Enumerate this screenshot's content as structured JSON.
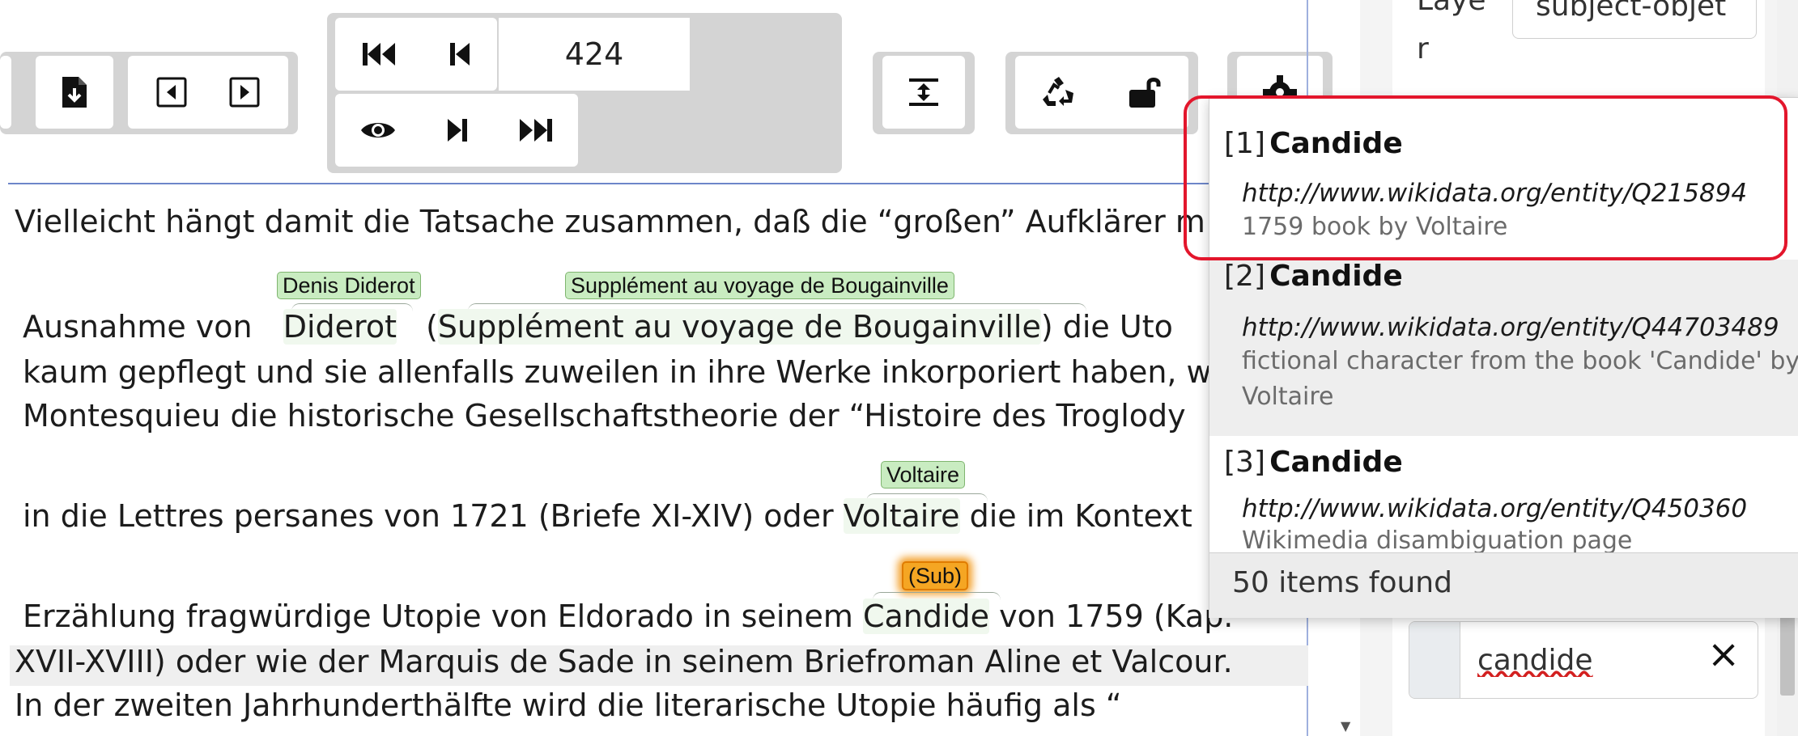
{
  "toolbar": {
    "page_number": "424"
  },
  "document": {
    "lines": [
      "Vielleicht hängt damit die Tatsache zusammen, daß die “großen” Aufklärer m",
      "kaum gepflegt und sie allenfalls zuweilen in ihre Werke inkorporiert haben, w",
      "Montesquieu die historische Gesellschaftstheorie der “Histoire des Troglody",
      "XVII-XVIII) oder wie der Marquis de Sade in seinem Briefroman Aline et Valcour.",
      "In der zweiten Jahrhunderthälfte wird die literarische Utopie häufig als “"
    ],
    "line2": {
      "pre": "Ausnahme von ",
      "span1": "Diderot",
      "mid": " (",
      "span2": "Supplément au voyage de Bougainville",
      "post": ") die Uto"
    },
    "line5": {
      "pre": "in die Lettres persanes von 1721 (Briefe XI-XIV) oder ",
      "span": "Voltaire",
      "post": " die im Kontext"
    },
    "line6": {
      "pre": "Erzählung fragwürdige Utopie von Eldorado in seinem ",
      "span": "Candide",
      "post": " von 1759 (Kap."
    },
    "annotations": {
      "diderot": "Denis Diderot",
      "supplement": "Supplément au voyage de Bougainville",
      "voltaire": "Voltaire",
      "sub": "(Sub)"
    }
  },
  "right_panel": {
    "layer_label_1": "Laye",
    "layer_label_2": "r",
    "layer_value": "subject-objet",
    "search_value": "candide",
    "clear_icon": "×"
  },
  "dropdown": {
    "options": [
      {
        "index": "[1]",
        "title": "Candide",
        "uri": "http://www.wikidata.org/entity/Q215894",
        "description": "1759 book by Voltaire"
      },
      {
        "index": "[2]",
        "title": "Candide",
        "uri": "http://www.wikidata.org/entity/Q44703489",
        "description_1": "fictional character from the book 'Candide' by",
        "description_2": "Voltaire"
      },
      {
        "index": "[3]",
        "title": "Candide",
        "uri": "http://www.wikidata.org/entity/Q450360",
        "description": "Wikimedia disambiguation page"
      }
    ],
    "found_text": "50 items found"
  },
  "colors": {
    "annotation_bg": "#c9ecc1",
    "selected_annotation": "#f5a623",
    "highlight_border": "#e3162c",
    "toolbar_group": "#d4d4d4"
  }
}
